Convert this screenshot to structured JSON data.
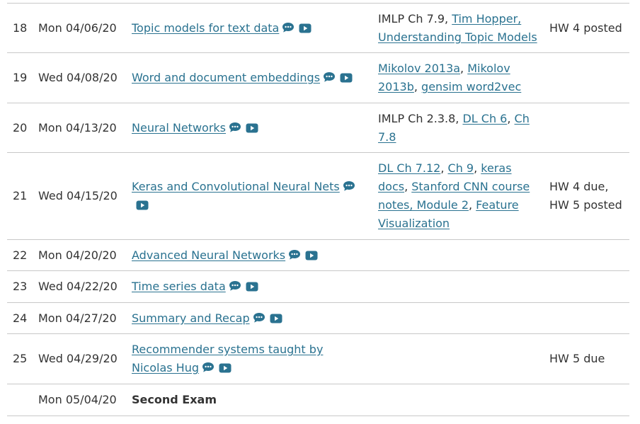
{
  "colors": {
    "link": "#2a7290",
    "text": "#333333",
    "border": "#c8c8c8"
  },
  "rows": [
    {
      "num": "18",
      "date": "Mon 04/06/20",
      "topic": "Topic models for text data",
      "topic_linked": true,
      "icons": [
        "comment-icon",
        "video-icon"
      ],
      "reading": [
        {
          "text": "IMLP Ch 7.9",
          "link": false
        },
        {
          "text": ", ",
          "link": false
        },
        {
          "text": "Tim Hopper, Understanding Topic Models",
          "link": true
        }
      ],
      "hw": "HW 4 posted"
    },
    {
      "num": "19",
      "date": "Wed 04/08/20",
      "topic": "Word and document embeddings",
      "topic_linked": true,
      "icons": [
        "comment-icon",
        "video-icon"
      ],
      "reading": [
        {
          "text": "Mikolov 2013a",
          "link": true
        },
        {
          "text": ", ",
          "link": false
        },
        {
          "text": "Mikolov 2013b",
          "link": true
        },
        {
          "text": ", ",
          "link": false
        },
        {
          "text": "gensim word2vec",
          "link": true
        }
      ],
      "hw": ""
    },
    {
      "num": "20",
      "date": "Mon 04/13/20",
      "topic": "Neural Networks",
      "topic_linked": true,
      "icons": [
        "comment-icon",
        "video-icon"
      ],
      "reading": [
        {
          "text": "IMLP Ch 2.3.8",
          "link": false
        },
        {
          "text": ", ",
          "link": false
        },
        {
          "text": "DL Ch 6",
          "link": true
        },
        {
          "text": ", ",
          "link": false
        },
        {
          "text": "Ch 7.8",
          "link": true
        }
      ],
      "hw": ""
    },
    {
      "num": "21",
      "date": "Wed 04/15/20",
      "topic": "Keras and Convolutional Neural Nets",
      "topic_linked": true,
      "icons": [
        "comment-icon",
        "video-icon"
      ],
      "reading": [
        {
          "text": "DL Ch 7.12",
          "link": true
        },
        {
          "text": ", ",
          "link": false
        },
        {
          "text": "Ch 9",
          "link": true
        },
        {
          "text": ", ",
          "link": false
        },
        {
          "text": "keras docs",
          "link": true
        },
        {
          "text": ", ",
          "link": false
        },
        {
          "text": "Stanford CNN course notes, Module 2",
          "link": true
        },
        {
          "text": ", ",
          "link": false
        },
        {
          "text": "Feature Visualization",
          "link": true
        }
      ],
      "hw": "HW 4 due, HW 5 posted"
    },
    {
      "num": "22",
      "date": "Mon 04/20/20",
      "topic": "Advanced Neural Networks",
      "topic_linked": true,
      "icons": [
        "comment-icon",
        "video-icon"
      ],
      "reading": [],
      "hw": ""
    },
    {
      "num": "23",
      "date": "Wed 04/22/20",
      "topic": "Time series data",
      "topic_linked": true,
      "icons": [
        "comment-icon",
        "video-icon"
      ],
      "reading": [],
      "hw": ""
    },
    {
      "num": "24",
      "date": "Mon 04/27/20",
      "topic": "Summary and Recap",
      "topic_linked": true,
      "icons": [
        "comment-icon",
        "video-icon"
      ],
      "reading": [],
      "hw": ""
    },
    {
      "num": "25",
      "date": "Wed 04/29/20",
      "topic": "Recommender systems taught by Nicolas Hug",
      "topic_linked": true,
      "icons": [
        "comment-icon",
        "video-icon"
      ],
      "reading": [],
      "hw": "HW 5 due"
    },
    {
      "num": "",
      "date": "Mon 05/04/20",
      "topic": "Second Exam",
      "topic_linked": false,
      "icons": [],
      "reading": [],
      "hw": ""
    }
  ]
}
